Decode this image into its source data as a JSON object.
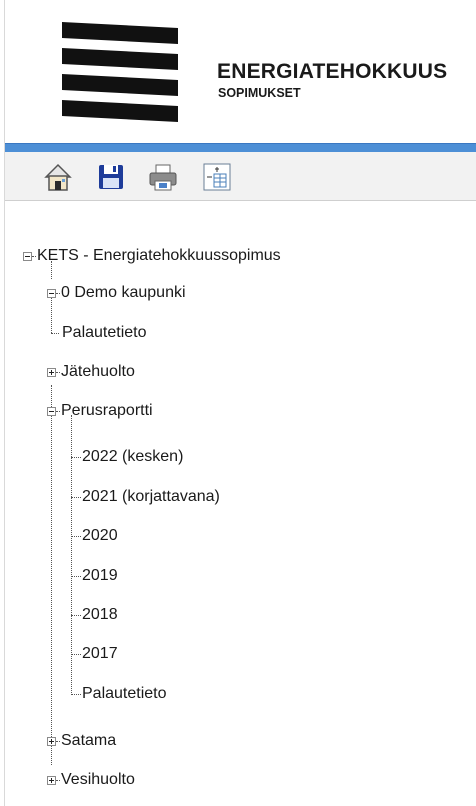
{
  "brand": {
    "title": "ENERGIATEHOKKUUS",
    "subtitle": "SOPIMUKSET"
  },
  "toolbar": {
    "buttons": [
      {
        "icon": "home-icon"
      },
      {
        "icon": "save-icon"
      },
      {
        "icon": "print-icon"
      },
      {
        "icon": "expand-tree-icon"
      }
    ]
  },
  "tree": {
    "root": "KETS - Energiatehokkuussopimus",
    "city": "0 Demo kaupunki",
    "nodes": {
      "palautetieto_1": "Palautetieto",
      "jatehuolto": "Jätehuolto",
      "perusraportti": "Perusraportti",
      "y2022": "2022 (kesken)",
      "y2021": "2021 (korjattavana)",
      "y2020": "2020",
      "y2019": "2019",
      "y2018": "2018",
      "y2017": "2017",
      "palautetieto_2": "Palautetieto",
      "satama": "Satama",
      "vesihuolto": "Vesihuolto"
    }
  }
}
